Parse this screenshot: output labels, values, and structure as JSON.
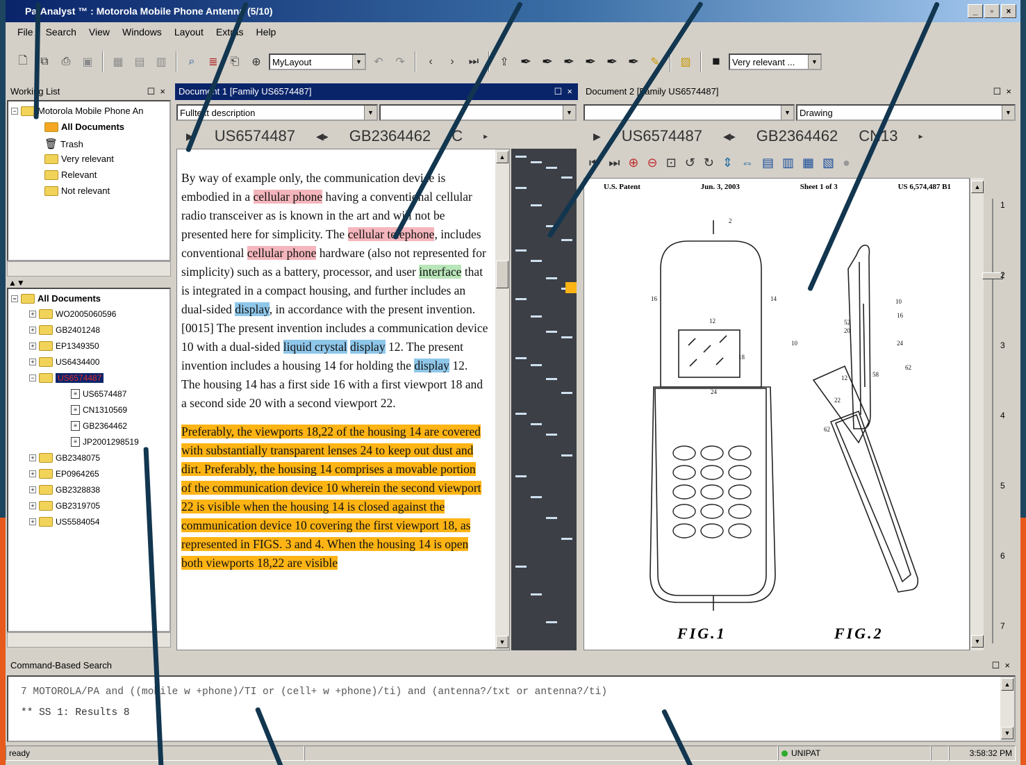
{
  "window": {
    "title": "PatAnalyst ™ : Motorola Mobile Phone Antenna (5/10)"
  },
  "menu": [
    "File",
    "Search",
    "View",
    "Windows",
    "Layout",
    "Extras",
    "Help"
  ],
  "toolbar": {
    "layout_value": "MyLayout",
    "relevance_value": "Very relevant ..."
  },
  "working_list": {
    "title": "Working List",
    "items": [
      {
        "label": "Motorola Mobile Phone An"
      },
      {
        "label": "All Documents"
      },
      {
        "label": "Trash"
      },
      {
        "label": "Very relevant"
      },
      {
        "label": "Relevant"
      },
      {
        "label": "Not relevant"
      }
    ]
  },
  "documents_tree": {
    "root": "All Documents",
    "families": [
      "WO2005060596",
      "GB2401248",
      "EP1349350",
      "US6434400",
      "US6574487"
    ],
    "selected_children": [
      "US6574487",
      "CN1310569",
      "GB2364462",
      "JP2001298519"
    ],
    "more_families": [
      "GB2348075",
      "EP0964265",
      "GB2328838",
      "GB2319705",
      "US5584054"
    ]
  },
  "doc1": {
    "title": "Document 1 [Family US6574487]",
    "view_select": "Fulltext description",
    "tabs": [
      "US6574487",
      "GB2364462",
      "C"
    ],
    "para1": [
      {
        "t": "By way of example only, the communication device is embodied in a ",
        "h": ""
      },
      {
        "t": "cellular phone",
        "h": "pink"
      },
      {
        "t": " having a conventional cellular radio transceiver as is known in the art and will not be presented here for simplicity. The ",
        "h": ""
      },
      {
        "t": "cellular telephone",
        "h": "pink"
      },
      {
        "t": ", includes conventional ",
        "h": ""
      },
      {
        "t": "cellular phone",
        "h": "pink"
      },
      {
        "t": " hardware (also not represented for simplicity) such as a battery, processor, and user ",
        "h": ""
      },
      {
        "t": "interface",
        "h": "green"
      },
      {
        "t": " that is integrated in a compact housing, and further includes an dual-sided ",
        "h": ""
      },
      {
        "t": "display",
        "h": "blue"
      },
      {
        "t": ", in accordance with the present invention.",
        "h": ""
      }
    ],
    "para2": [
      {
        "t": "[0015] The present invention includes a communication device 10 with a dual-sided ",
        "h": ""
      },
      {
        "t": "liquid crystal",
        "h": "blue"
      },
      {
        "t": " ",
        "h": ""
      },
      {
        "t": "display",
        "h": "blue"
      },
      {
        "t": " 12. The present invention includes a housing 14 for holding the ",
        "h": ""
      },
      {
        "t": "display",
        "h": "blue"
      },
      {
        "t": " 12. The housing 14 has a first side 16 with a first viewport 18 and a second side 20 with a second viewport 22.",
        "h": ""
      }
    ],
    "para3": [
      {
        "t": "Preferably, the viewports 18,22 of the housing 14 are covered with substantially transparent lenses 24 to keep out dust and dirt. Preferably, the housing 14 comprises a movable portion of the communication device 10 wherein the second viewport 22 is visible when the housing 14 is closed against the communication device 10 covering the first viewport 18, as represented in FIGS. 3 and 4. When the housing 14 is open both viewports 18,22 are visible",
        "h": "orange"
      }
    ]
  },
  "doc2": {
    "title": "Document 2 [Family US6574487]",
    "view_select": "Drawing",
    "tabs": [
      "US6574487",
      "GB2364462",
      "CN13"
    ],
    "header": {
      "left": "U.S. Patent",
      "date": "Jun. 3, 2003",
      "sheet": "Sheet 1 of 3",
      "num": "US 6,574,487 B1"
    },
    "fig1": "FIG.1",
    "fig2": "FIG.2",
    "ruler": [
      "1",
      "2",
      "3",
      "4",
      "5",
      "6",
      "7"
    ],
    "labels": [
      "2",
      "16",
      "14",
      "12",
      "10",
      "24",
      "18",
      "52",
      "20",
      "24",
      "12",
      "22",
      "62",
      "10",
      "58",
      "62",
      "16"
    ]
  },
  "command": {
    "title": "Command-Based Search",
    "line1": "7  MOTOROLA/PA and ((mobile w +phone)/TI or (cell+ w +phone)/ti) and (antenna?/txt or antenna?/ti)",
    "line2": "** SS 1: Results 8"
  },
  "status": {
    "text": "ready",
    "db": "UNIPAT",
    "time": "3:58:32 PM"
  }
}
